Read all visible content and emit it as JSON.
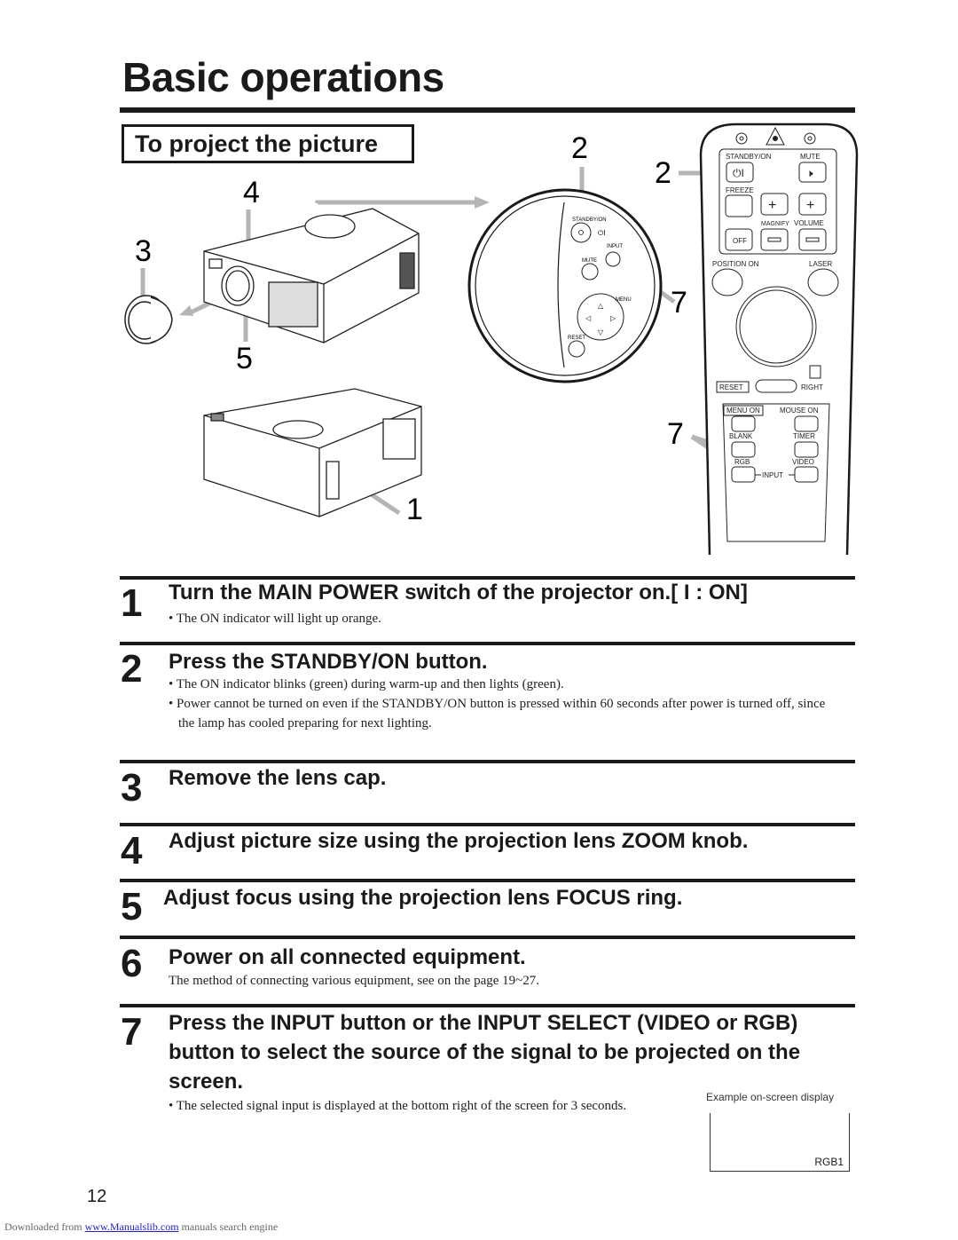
{
  "page": {
    "title": "Basic operations",
    "section_heading": "To project the picture",
    "page_number": "12"
  },
  "figure": {
    "callouts": [
      "4",
      "3",
      "5",
      "1",
      "2",
      "2",
      "7",
      "7"
    ],
    "control_panel": {
      "labels": {
        "standby_on": "STANDBY/ON",
        "input": "INPUT",
        "mute": "MUTE",
        "menu": "MENU",
        "reset": "RESET"
      }
    },
    "remote": {
      "labels": {
        "standby_on": "STANDBY/ON",
        "mute": "MUTE",
        "freeze": "FREEZE",
        "magnify": "MAGNIFY",
        "volume": "VOLUME",
        "off": "OFF",
        "position_on": "POSITION  ON",
        "laser": "LASER",
        "reset": "RESET",
        "right": "RIGHT",
        "menu_on": "MENU  ON",
        "mouse_on": "MOUSE  ON",
        "blank": "BLANK",
        "timer": "TIMER",
        "rgb": "RGB",
        "video": "VIDEO",
        "input": "INPUT"
      }
    }
  },
  "steps": [
    {
      "number": "1",
      "heading": "Turn the MAIN POWER switch of the projector on.[ I : ON]",
      "notes": [
        "• The ON indicator will light up orange."
      ]
    },
    {
      "number": "2",
      "heading": "Press the STANDBY/ON button.",
      "notes": [
        "• The ON indicator blinks (green) during warm-up and then lights (green).",
        "• Power cannot be turned on even if the STANDBY/ON button is pressed within 60 seconds after power is turned off, since the lamp has cooled preparing for next lighting."
      ]
    },
    {
      "number": "3",
      "heading": "Remove the lens cap.",
      "notes": []
    },
    {
      "number": "4",
      "heading": "Adjust picture size using the projection lens ZOOM knob.",
      "notes": []
    },
    {
      "number": "5",
      "heading": "Adjust focus using the projection lens FOCUS ring.",
      "notes": []
    },
    {
      "number": "6",
      "heading": "Power on all connected equipment.",
      "notes": [
        "The method of connecting various equipment, see on the page 19~27."
      ]
    },
    {
      "number": "7",
      "heading": "Press the INPUT button or the INPUT SELECT (VIDEO or RGB) button to select the source of the signal to be projected on the screen.",
      "notes": [
        "• The selected signal input is displayed at the bottom right of the screen for 3 seconds."
      ]
    }
  ],
  "osd_example": {
    "caption": "Example on-screen display",
    "signal_label": "RGB1"
  },
  "footer": {
    "prefix": "Downloaded from ",
    "link_text": "www.Manualslib.com",
    "suffix": "  manuals search engine"
  }
}
